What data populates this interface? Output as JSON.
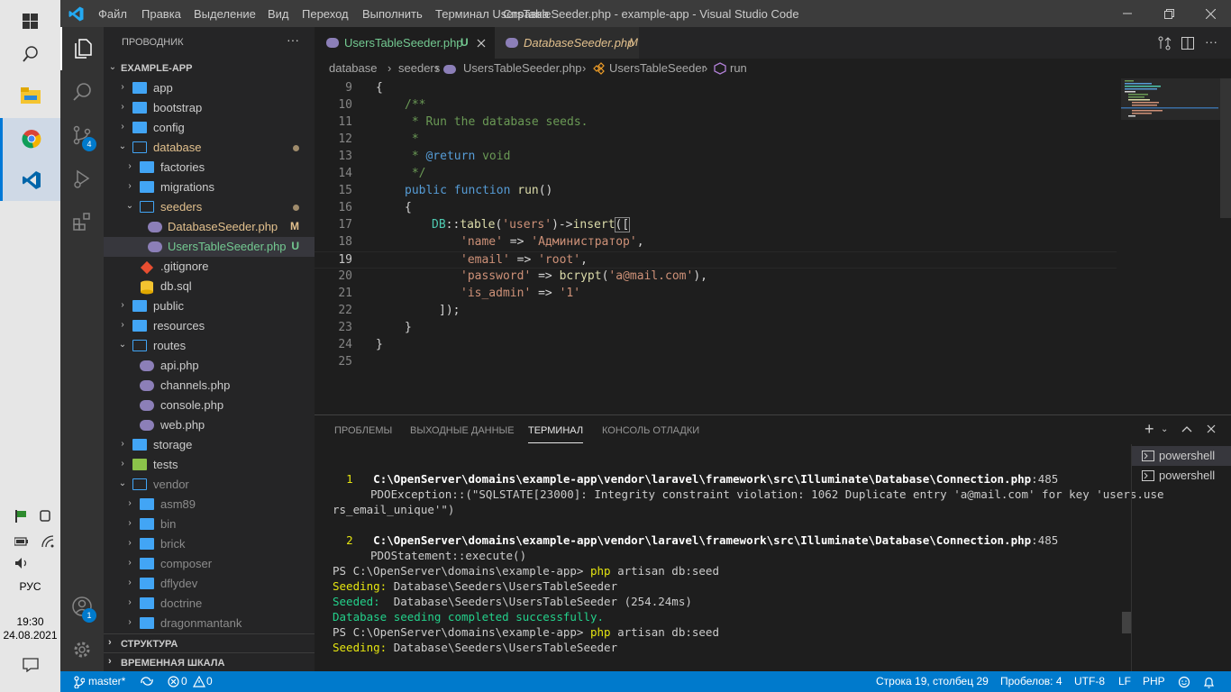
{
  "window": {
    "title": "UsersTableSeeder.php - example-app - Visual Studio Code",
    "menu": [
      "Файл",
      "Правка",
      "Выделение",
      "Вид",
      "Переход",
      "Выполнить",
      "Терминал",
      "Справка"
    ]
  },
  "taskbar": {
    "lang": "РУС",
    "time": "19:30",
    "date": "24.08.2021"
  },
  "activity": {
    "scm_badge": "4",
    "accounts_badge": "1"
  },
  "sidebar": {
    "title": "ПРОВОДНИК",
    "root": "EXAMPLE-APP",
    "items": [
      {
        "label": "app"
      },
      {
        "label": "bootstrap"
      },
      {
        "label": "config"
      },
      {
        "label": "database"
      },
      {
        "label": "factories"
      },
      {
        "label": "migrations"
      },
      {
        "label": "seeders"
      },
      {
        "label": "DatabaseSeeder.php",
        "status": "M"
      },
      {
        "label": "UsersTableSeeder.php",
        "status": "U"
      },
      {
        "label": ".gitignore"
      },
      {
        "label": "db.sql"
      },
      {
        "label": "public"
      },
      {
        "label": "resources"
      },
      {
        "label": "routes"
      },
      {
        "label": "api.php"
      },
      {
        "label": "channels.php"
      },
      {
        "label": "console.php"
      },
      {
        "label": "web.php"
      },
      {
        "label": "storage"
      },
      {
        "label": "tests"
      },
      {
        "label": "vendor"
      },
      {
        "label": "asm89"
      },
      {
        "label": "bin"
      },
      {
        "label": "brick"
      },
      {
        "label": "composer"
      },
      {
        "label": "dflydev"
      },
      {
        "label": "doctrine"
      },
      {
        "label": "dragonmantank"
      }
    ],
    "outline": "СТРУКТУРА",
    "timeline": "ВРЕМЕННАЯ ШКАЛА"
  },
  "tabs": [
    {
      "label": "UsersTableSeeder.php",
      "status": "U"
    },
    {
      "label": "DatabaseSeeder.php",
      "status": "M"
    }
  ],
  "breadcrumb": [
    "database",
    "seeders",
    "UsersTableSeeder.php",
    "UsersTableSeeder",
    "run"
  ],
  "editor": {
    "line_numbers": [
      "9",
      "10",
      "11",
      "12",
      "13",
      "14",
      "15",
      "16",
      "17",
      "18",
      "19",
      "20",
      "21",
      "22",
      "23",
      "24",
      "25"
    ],
    "lines": {
      "l9": "{",
      "l10": "/**",
      "l11": " * Run the database seeds.",
      "l12": " *",
      "l13a": " * ",
      "l13b": "@return",
      "l13c": " void",
      "l14": " */",
      "l15a": "public",
      "l15b": "function",
      "l15c": "run",
      "l15d": "()",
      "l16": "{",
      "l17a": "DB",
      "l17b": "::",
      "l17c": "table",
      "l17d": "(",
      "l17e": "'users'",
      "l17f": ")->",
      "l17g": "insert",
      "l17h": "([",
      "l18a": "'name'",
      "l18b": " => ",
      "l18c": "'Администратор'",
      "l18d": ",",
      "l19a": "'email'",
      "l19b": " => ",
      "l19c": "'root'",
      "l19d": ",",
      "l20a": "'password'",
      "l20b": " => ",
      "l20c": "bcrypt",
      "l20d": "(",
      "l20e": "'a@mail.com'",
      "l20f": "),",
      "l21a": "'is_admin'",
      "l21b": " => ",
      "l21c": "'1'",
      "l22": "]);",
      "l23": "}",
      "l24": "}"
    }
  },
  "panel": {
    "tabs": [
      "ПРОБЛЕМЫ",
      "ВЫХОДНЫЕ ДАННЫЕ",
      "ТЕРМИНАЛ",
      "КОНСОЛЬ ОТЛАДКИ"
    ],
    "terminals": [
      "powershell",
      "powershell"
    ],
    "terminal": {
      "t1_idx": "1",
      "t1_path": "C:\\OpenServer\\domains\\example-app\\vendor\\laravel\\framework\\src\\Illuminate\\Database\\Connection.php",
      "t1_line": ":485",
      "t2": "PDOException::(\"SQLSTATE[23000]: Integrity constraint violation: 1062 Duplicate entry 'a@mail.com' for key 'users.use",
      "t3": "rs_email_unique'\")",
      "t4_idx": "2",
      "t4_path": "C:\\OpenServer\\domains\\example-app\\vendor\\laravel\\framework\\src\\Illuminate\\Database\\Connection.php",
      "t4_line": ":485",
      "t5": "PDOStatement::execute()",
      "t6_prompt": "PS C:\\OpenServer\\domains\\example-app> ",
      "t6_cmd": "php",
      "t6_args": " artisan db:seed",
      "t7_label": "Seeding:",
      "t7_text": " Database\\Seeders\\UsersTableSeeder",
      "t8_label": "Seeded:",
      "t8_text": "  Database\\Seeders\\UsersTableSeeder (254.24ms)",
      "t9": "Database seeding completed successfully.",
      "t10_prompt": "PS C:\\OpenServer\\domains\\example-app> ",
      "t10_cmd": "php",
      "t10_args": " artisan db:seed",
      "t11_label": "Seeding:",
      "t11_text": " Database\\Seeders\\UsersTableSeeder"
    }
  },
  "statusbar": {
    "branch": "master*",
    "problems": "0",
    "warnings": "0",
    "position": "Строка 19, столбец 29",
    "spaces": "Пробелов: 4",
    "encoding": "UTF-8",
    "eol": "LF",
    "language": "PHP"
  },
  "colors": {
    "accent": "#007acc",
    "titlebar": "#3c3c3c",
    "editor_bg": "#1e1e1e",
    "sidebar_bg": "#252526"
  }
}
